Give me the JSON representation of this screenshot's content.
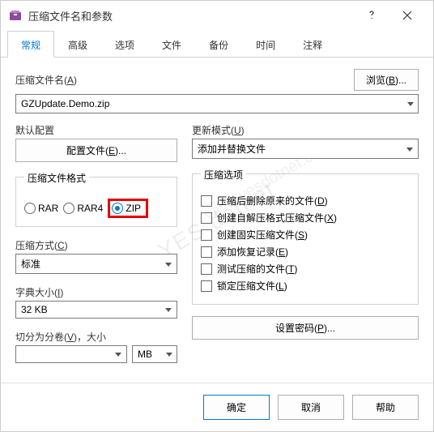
{
  "titlebar": {
    "title": "压缩文件名和参数"
  },
  "tabs": [
    "常规",
    "高级",
    "选项",
    "文件",
    "备份",
    "时间",
    "注释"
  ],
  "activeTab": 0,
  "archiveNameLabel": "压缩文件名(A)",
  "browseLabel": "浏览(B)...",
  "archiveName": "GZUpdate.Demo.zip",
  "defaultConfigLabel": "默认配置",
  "configFilesBtn": "配置文件(E)...",
  "updateModeLabel": "更新模式(U)",
  "updateModeValue": "添加并替换文件",
  "formatLabel": "压缩文件格式",
  "formats": {
    "rar": "RAR",
    "rar4": "RAR4",
    "zip": "ZIP",
    "selected": "zip"
  },
  "methodLabel": "压缩方式(C)",
  "methodValue": "标准",
  "dictLabel": "字典大小(I)",
  "dictValue": "32 KB",
  "volumeLabel": "切分为分卷(V)，大小",
  "volumeUnit": "MB",
  "optionsLabel": "压缩选项",
  "options": [
    "压缩后删除原来的文件(D)",
    "创建自解压格式压缩文件(X)",
    "创建固实压缩文件(S)",
    "添加恢复记录(E)",
    "测试压缩的文件(T)",
    "锁定压缩文件(L)"
  ],
  "setPasswordBtn": "设置密码(P)...",
  "footer": {
    "ok": "确定",
    "cancel": "取消",
    "help": "帮助"
  },
  "watermark": "YES  dotnet",
  "watermark2": "www.yesdotnet.com"
}
